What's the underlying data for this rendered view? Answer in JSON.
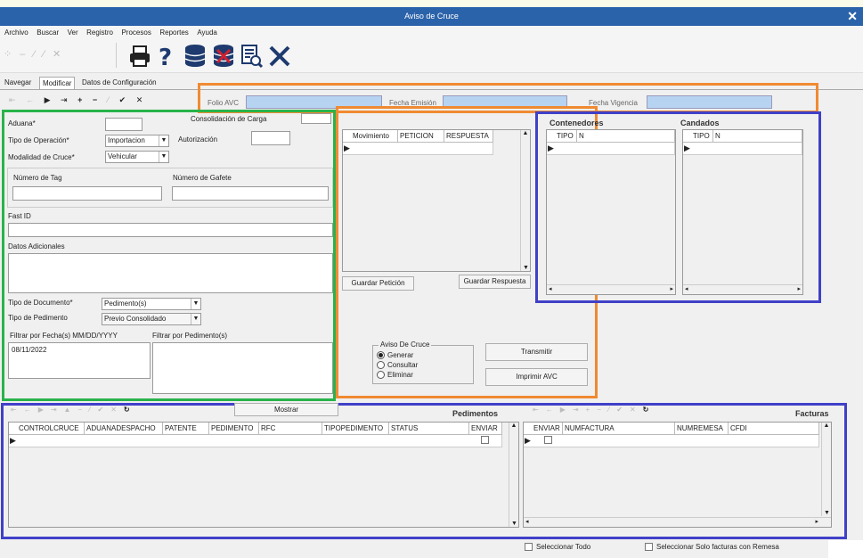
{
  "window": {
    "title": "Aviso de Cruce",
    "close_glyph": "✕"
  },
  "menu": [
    "Archivo",
    "Buscar",
    "Ver",
    "Registro",
    "Procesos",
    "Reportes",
    "Ayuda"
  ],
  "toolbar_icons": [
    "printer-icon",
    "help-icon",
    "database-icon",
    "database-delete-icon",
    "search-report-icon",
    "close-x-icon"
  ],
  "tabs": [
    "Navegar",
    "Modificar",
    "Datos de Configuración"
  ],
  "nav_buttons": [
    "⇤",
    "←",
    "▶",
    "⇥",
    "+",
    "−",
    "⁄",
    "✔",
    "✕"
  ],
  "header": {
    "folio_label": "Folio AVC",
    "fecha_emision_label": "Fecha Emisión",
    "fecha_vigencia_label": "Fecha Vigencia"
  },
  "form": {
    "aduana_label": "Aduana*",
    "consolidacion_label": "Consolidación de Carga",
    "tipo_operacion_label": "Tipo de Operación*",
    "tipo_operacion_value": "Importacion",
    "autorizacion_label": "Autorización",
    "modalidad_label": "Modalidad de Cruce*",
    "modalidad_value": "Vehicular",
    "numero_tag_label": "Número de Tag",
    "numero_gafete_label": "Número de Gafete",
    "fast_id_label": "Fast ID",
    "datos_adicionales_label": "Datos Adicionales",
    "tipo_documento_label": "Tipo de Documento*",
    "tipo_documento_value": "Pedimento(s)",
    "tipo_pedimento_label": "Tipo de Pedimento",
    "tipo_pedimento_value": "Previo Consolidado",
    "filtrar_fecha_label": "Filtrar por Fecha(s) MM/DD/YYYY",
    "filtrar_fecha_value": "08/11/2022",
    "filtrar_pedimento_label": "Filtrar por Pedimento(s)"
  },
  "peticion": {
    "columns": [
      "Movimiento",
      "PETICION",
      "RESPUESTA"
    ],
    "guardar_peticion": "Guardar Petición",
    "guardar_respuesta": "Guardar Respuesta"
  },
  "aviso": {
    "group_label": "Aviso De Cruce",
    "options": [
      "Generar",
      "Consultar",
      "Eliminar"
    ],
    "selected": "Generar",
    "transmitir": "Transmitir",
    "imprimir": "Imprimir AVC"
  },
  "contenedores": {
    "title": "Contenedores",
    "columns": [
      "TIPO",
      "N"
    ]
  },
  "candados": {
    "title": "Candados",
    "columns": [
      "TIPO",
      "N"
    ]
  },
  "pedimentos": {
    "title": "Pedimentos",
    "mostrar": "Mostrar",
    "columns": [
      "CONTROLCRUCE",
      "ADUANADESPACHO",
      "PATENTE",
      "PEDIMENTO",
      "RFC",
      "TIPOPEDIMENTO",
      "STATUS",
      "ENVIAR"
    ]
  },
  "facturas": {
    "title": "Facturas",
    "columns": [
      "ENVIAR",
      "NUMFACTURA",
      "NUMREMESA",
      "CFDI"
    ]
  },
  "footer": {
    "seleccionar_todo": "Seleccionar Todo",
    "seleccionar_remesa": "Seleccionar Solo facturas con Remesa"
  },
  "colors": {
    "orange": "#f08a32",
    "green": "#29b34a",
    "blue": "#4040c8",
    "titlebar": "#2b63aa",
    "field_blue": "#b7d3f2"
  }
}
